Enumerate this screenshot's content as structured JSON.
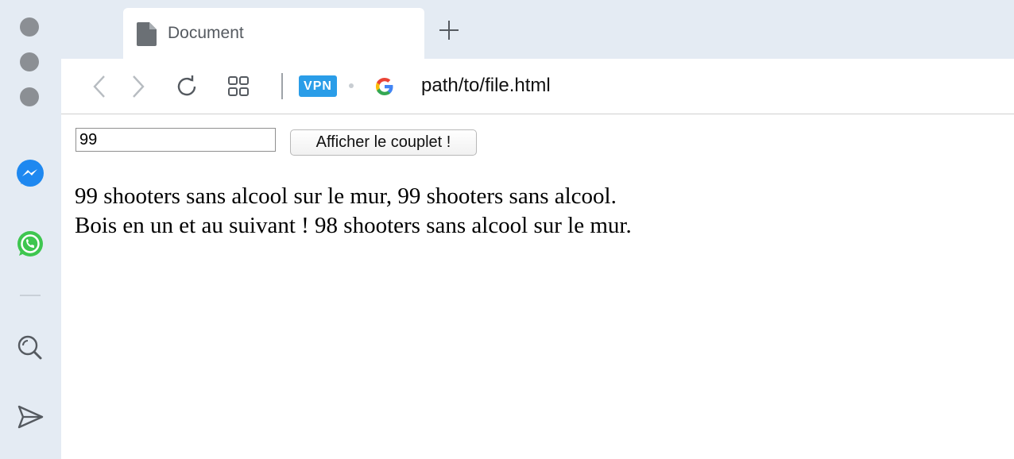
{
  "browser": {
    "tab": {
      "title": "Document",
      "icon": "document-icon"
    },
    "new_tab_icon": "plus-icon",
    "toolbar": {
      "vpn_label": "VPN",
      "url": "path/to/file.html",
      "search_engine_icon": "google-icon"
    },
    "sidebar": {
      "window_controls": [
        "close",
        "minimize",
        "maximize"
      ],
      "apps": [
        "messenger-icon",
        "whatsapp-icon"
      ],
      "tools": [
        "search-icon",
        "send-icon"
      ]
    },
    "colors": {
      "chrome_bg": "#e4ebf3",
      "vpn_badge": "#2a9de8",
      "messenger": "#1e88f0",
      "whatsapp": "#3ec64f"
    }
  },
  "page": {
    "input_value": "99",
    "button_label": "Afficher le couplet !",
    "verse_lines": [
      "99 shooters sans alcool sur le mur, 99 shooters sans alcool.",
      "Bois en un et au suivant ! 98 shooters sans alcool sur le mur."
    ]
  }
}
